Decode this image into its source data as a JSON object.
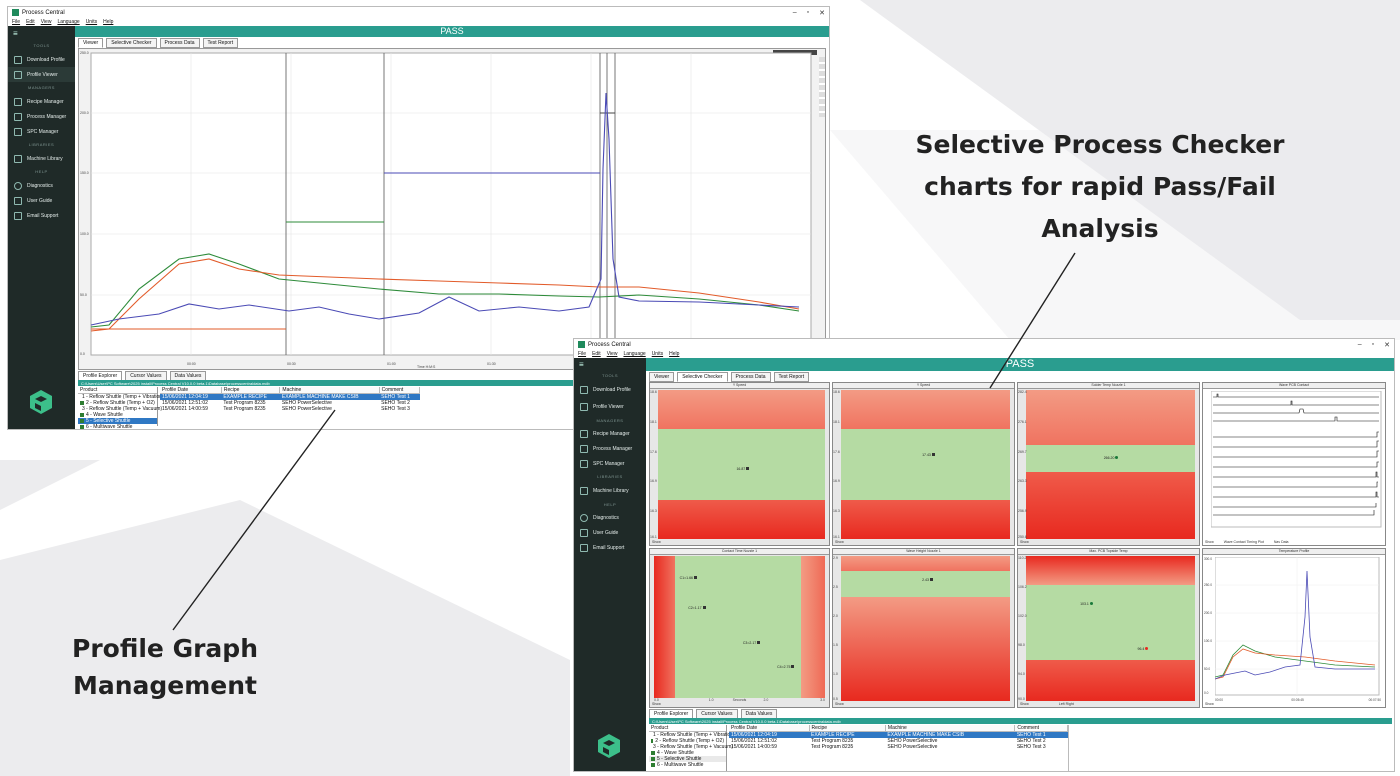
{
  "colors": {
    "accent": "#2a9d8f",
    "sidebar": "#1f2a28",
    "selection": "#2f78c4",
    "red": "#e8291f",
    "green": "#b5dba3",
    "orange": "#f07f3a"
  },
  "window": {
    "title": "Process Central",
    "menu": [
      "File",
      "Edit",
      "View",
      "Language",
      "Units",
      "Help"
    ]
  },
  "status": "PASS",
  "sidebar": {
    "sections": {
      "tools": "TOOLS",
      "managers": "MANAGERS",
      "libraries": "LIBRARIES",
      "help": "HELP"
    },
    "items": [
      {
        "label": "Download Profile",
        "icon": "download-icon"
      },
      {
        "label": "Profile Viewer",
        "icon": "graph-icon"
      },
      {
        "label": "Recipe Manager",
        "icon": "sliders-icon"
      },
      {
        "label": "Process Manager",
        "icon": "grid-icon"
      },
      {
        "label": "SPC Manager",
        "icon": "sigma-icon"
      },
      {
        "label": "Machine Library",
        "icon": "machine-icon"
      },
      {
        "label": "Diagnostics",
        "icon": "search-icon"
      },
      {
        "label": "User Guide",
        "icon": "info-icon"
      },
      {
        "label": "Email Support",
        "icon": "mail-icon"
      }
    ]
  },
  "tabs": [
    "Viewer",
    "Selective Checker",
    "Process Data",
    "Test Report"
  ],
  "bottom_tabs": [
    "Profile Explorer",
    "Cursor Values",
    "Data Values"
  ],
  "path": "C:\\Users\\User\\PC Software\\2025 install\\Process Central V10.0.0 beta.1\\Database\\processcentraldata.mdb",
  "products_header": "Product",
  "products": [
    "1 - Reflow Shuttle (Temp + Vibration)",
    "2 - Reflow Shuttle (Temp + O2)",
    "3 - Reflow Shuttle (Temp + Vacuum)",
    "4 - Wave Shuttle",
    "5 - Selective Shuttle",
    "6 - Multiwave Shuttle"
  ],
  "products_selected": 4,
  "profile_table": {
    "headers": [
      "Profile Date",
      "Recipe",
      "Machine",
      "Comment"
    ],
    "rows": [
      [
        "15/06/2021 12:04:19",
        "EXAMPLE RECIPE",
        "EXAMPLE MACHINE MAKE CSIB",
        "SEHO Test 1"
      ],
      [
        "15/06/2021 12:51:02",
        "Test Program 8235",
        "SEHO PowerSelective",
        "SEHO Test 2"
      ],
      [
        "15/06/2021 14:00:59",
        "Test Program 8235",
        "SEHO PowerSelective",
        "SEHO Test 3"
      ]
    ]
  },
  "profile_graph": {
    "y_ticks": [
      "250.0",
      "200.0",
      "150.0",
      "100.0",
      "50.0",
      "0.0"
    ],
    "x_ticks": [
      "00:00",
      "00:30",
      "01:00",
      "01:30",
      "02:00"
    ],
    "x_label": "Time H:M:S"
  },
  "checker": {
    "panels": [
      {
        "title": "Y Speed",
        "units": "mm/min",
        "y_ticks": [
          "18.6",
          "18.1",
          "17.6",
          "16.9",
          "16.3",
          "16.1"
        ],
        "value": "16.87",
        "foot": "Show"
      },
      {
        "title": "Y Speed",
        "units": "mm/min",
        "y_ticks": [
          "18.6",
          "18.1",
          "17.6",
          "16.9",
          "16.3",
          "16.1"
        ],
        "value": "17.43",
        "foot": "Show"
      },
      {
        "title": "Solder Temp Nozzle 1",
        "units": "°C",
        "y_ticks": [
          "282.4",
          "276.1",
          "269.7",
          "263.3",
          "256.9",
          "250.6"
        ],
        "value": "266.20",
        "foot": "Show"
      },
      {
        "title": "Wave PCB Contact",
        "foot": "Show",
        "legend": [
          "Wave Contact Timing Plot",
          "Nav Data"
        ]
      },
      {
        "title": "Contact Time Nozzle 1",
        "units": "",
        "values": [
          "C1=1.66",
          "C2=1.17",
          "C3=2.17",
          "C4=2.75"
        ],
        "x_ticks": [
          "0.0",
          "1.0",
          "2.0",
          "3.0"
        ],
        "x_label": "Seconds",
        "foot": "Show"
      },
      {
        "title": "Wave Height Nozzle 1",
        "units": "mm",
        "y_ticks": [
          "2.9",
          "2.5",
          "2.0",
          "1.5",
          "1.0",
          "0.5"
        ],
        "value": "2.43",
        "foot": "Show"
      },
      {
        "title": "Max. PCB Topside Temp",
        "units": "°C",
        "y_ticks": [
          "110.2",
          "106.2",
          "102.0",
          "98.0",
          "94.0",
          "90.0"
        ],
        "values": [
          "103.1",
          "96.4"
        ],
        "x_label": "Left Right",
        "foot": "Show"
      },
      {
        "title": "Temperature Profile",
        "y_ticks": [
          "300.0",
          "250.0",
          "200.0",
          "100.0",
          "50.0",
          "0.0"
        ],
        "x_ticks": [
          "00:00",
          "00:05:45",
          "00:07:50"
        ],
        "foot": "Show"
      }
    ]
  },
  "annotations": {
    "checker": "Selective Process Checker charts for rapid Pass/Fail Analysis",
    "graph": "Profile Graph Management"
  }
}
